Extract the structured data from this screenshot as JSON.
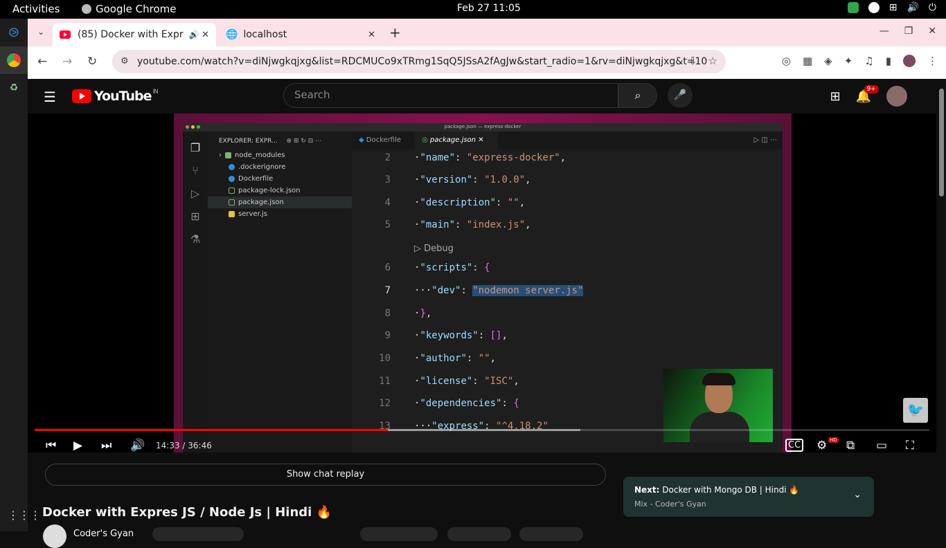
{
  "system": {
    "activities": "Activities",
    "app_name": "Google Chrome",
    "clock": "Feb 27  11:05"
  },
  "browser": {
    "tabs": [
      {
        "label": "(85) Docker with Expr"
      },
      {
        "label": "localhost"
      }
    ],
    "url": "youtube.com/watch?v=diNjwgkqjxg&list=RDCMUCo9xTRmg1SqQ5JSsA2fAgJw&start_radio=1&rv=diNjwgkqjxg&t=10"
  },
  "youtube": {
    "logo_text": "YouTube",
    "region": "IN",
    "search_placeholder": "Search",
    "notifications_badge": "9+",
    "time_display": "14:33 / 36:46",
    "progress": {
      "played": 0.395,
      "buffered": 0.61
    },
    "chat_replay_label": "Show chat replay",
    "video_title": "Docker with Expres JS / Node Js | Hindi 🔥",
    "channel_name": "Coder's Gyan",
    "next": {
      "prefix": "Next:",
      "title": "Docker with Mongo DB | Hindi 🔥",
      "subtitle": "Mix - Coder's Gyan"
    }
  },
  "vscode": {
    "window_title": "package.json — express-docker",
    "explorer_title": "EXPLORER: EXPR...",
    "files": [
      "node_modules",
      ".dockerignore",
      "Dockerfile",
      "package-lock.json",
      "package.json",
      "server.js"
    ],
    "tabs": [
      "Dockerfile",
      "package.json"
    ],
    "codelens": "▷ Debug",
    "lines": [
      {
        "n": "2",
        "text": "\"name\": \"express-docker\","
      },
      {
        "n": "3",
        "text": "\"version\": \"1.0.0\","
      },
      {
        "n": "4",
        "text": "\"description\": \"\","
      },
      {
        "n": "5",
        "text": "\"main\": \"index.js\","
      },
      {
        "n": "6",
        "text": "\"scripts\": {"
      },
      {
        "n": "7",
        "text": "\"dev\": \"nodemon server.js\""
      },
      {
        "n": "8",
        "text": "},"
      },
      {
        "n": "9",
        "text": "\"keywords\": [],"
      },
      {
        "n": "10",
        "text": "\"author\": \"\","
      },
      {
        "n": "11",
        "text": "\"license\": \"ISC\","
      },
      {
        "n": "12",
        "text": "\"dependencies\": {"
      },
      {
        "n": "13",
        "text": "\"express\": \"^4.18.2\""
      }
    ]
  }
}
